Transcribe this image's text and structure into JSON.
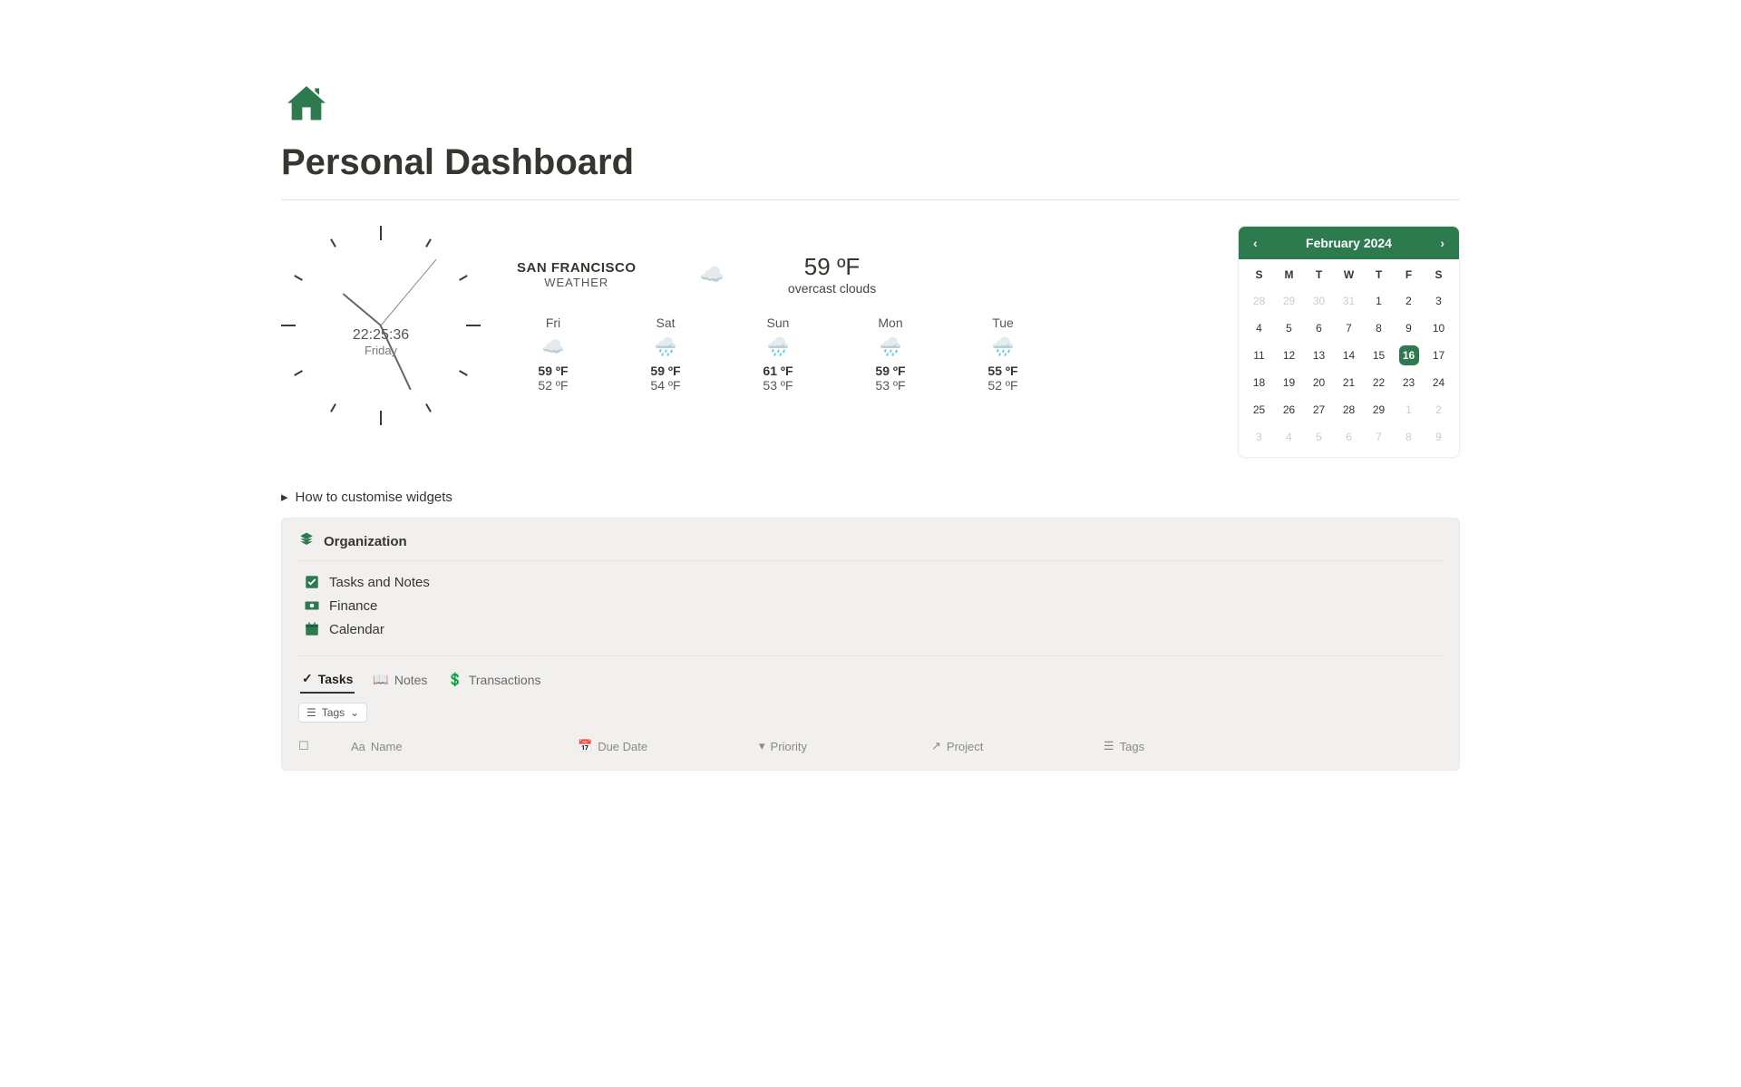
{
  "page": {
    "title": "Personal Dashboard"
  },
  "clock": {
    "time": "22:25:36",
    "day": "Friday"
  },
  "weather": {
    "city": "SAN FRANCISCO",
    "label": "WEATHER",
    "now_temp": "59 ºF",
    "now_desc": "overcast clouds",
    "forecast": [
      {
        "day": "Fri",
        "hi": "59 ºF",
        "lo": "52 ºF"
      },
      {
        "day": "Sat",
        "hi": "59 ºF",
        "lo": "54 ºF"
      },
      {
        "day": "Sun",
        "hi": "61 ºF",
        "lo": "53 ºF"
      },
      {
        "day": "Mon",
        "hi": "59 ºF",
        "lo": "53 ºF"
      },
      {
        "day": "Tue",
        "hi": "55 ºF",
        "lo": "52 ºF"
      }
    ]
  },
  "calendar": {
    "month_label": "February 2024",
    "dow": [
      "S",
      "M",
      "T",
      "W",
      "T",
      "F",
      "S"
    ],
    "today": 16,
    "leading_out": [
      28,
      29,
      30,
      31
    ],
    "days": [
      1,
      2,
      3,
      4,
      5,
      6,
      7,
      8,
      9,
      10,
      11,
      12,
      13,
      14,
      15,
      16,
      17,
      18,
      19,
      20,
      21,
      22,
      23,
      24,
      25,
      26,
      27,
      28,
      29
    ],
    "trailing_out": [
      1,
      2,
      3,
      4,
      5,
      6,
      7,
      8,
      9
    ]
  },
  "disclosure": {
    "label": "How to customise widgets"
  },
  "organization": {
    "header": "Organization",
    "links": [
      {
        "icon": "checkbox",
        "label": "Tasks and Notes"
      },
      {
        "icon": "money",
        "label": "Finance"
      },
      {
        "icon": "calendar",
        "label": "Calendar"
      }
    ],
    "tabs": [
      {
        "label": "Tasks",
        "active": true
      },
      {
        "label": "Notes",
        "active": false
      },
      {
        "label": "Transactions",
        "active": false
      }
    ],
    "chip": {
      "label": "Tags"
    },
    "columns": {
      "name": "Name",
      "due_date": "Due Date",
      "priority": "Priority",
      "project": "Project",
      "tags": "Tags"
    }
  },
  "colors": {
    "primary_green": "#2d7a4f"
  }
}
